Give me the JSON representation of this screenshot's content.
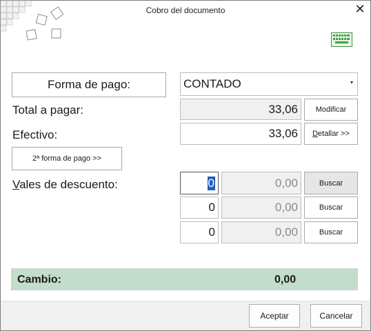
{
  "window": {
    "title": "Cobro del documento",
    "close_glyph": "✕"
  },
  "icons": {
    "logo": "tiles-logo-icon",
    "keyboard": "keyboard-icon",
    "dropdown": "dropdown-arrow-icon"
  },
  "payment": {
    "method_button": "Forma de pago:",
    "method_value": "CONTADO",
    "dropdown_arrow": "▾",
    "total_label": "Total a pagar:",
    "total_value": "33,06",
    "modify_button": "Modificar",
    "cash_label": "Efectivo:",
    "cash_value": "33,06",
    "detail_button": "Detallar >>",
    "second_method_button": "2ª forma de pago >>"
  },
  "vouchers": {
    "label": "Vales de descuento:",
    "rows": [
      {
        "qty": "0",
        "amount": "0,00",
        "button": "Buscar"
      },
      {
        "qty": "0",
        "amount": "0,00",
        "button": "Buscar"
      },
      {
        "qty": "0",
        "amount": "0,00",
        "button": "Buscar"
      }
    ]
  },
  "change": {
    "label": "Cambio:",
    "value": "0,00"
  },
  "footer": {
    "accept": "Aceptar",
    "cancel": "Cancelar"
  },
  "colors": {
    "change_bg": "#c3dccc",
    "keyboard_green": "#4caf50",
    "selection_blue": "#1f5fbf"
  }
}
